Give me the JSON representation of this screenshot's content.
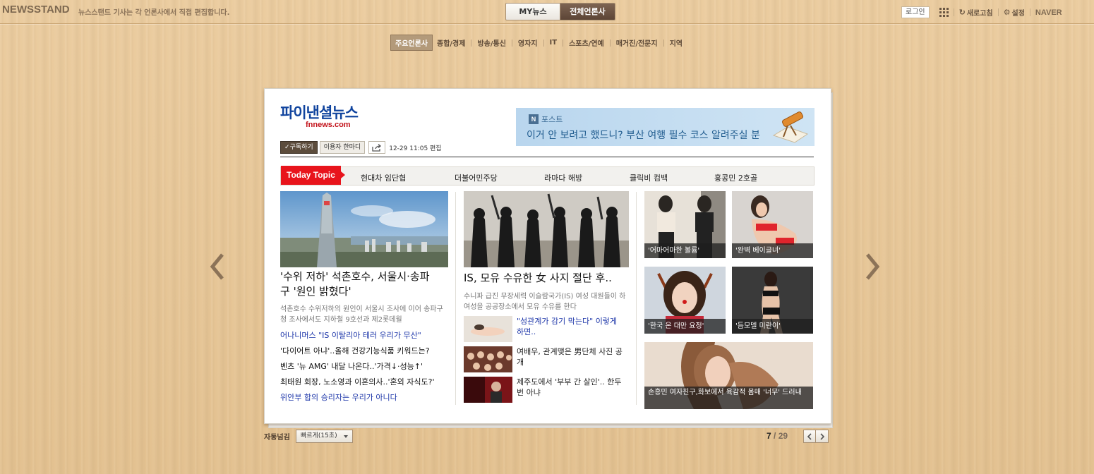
{
  "topbar": {
    "logo": "NEWSSTAND",
    "tagline": "뉴스스탠드 기사는 각 언론사에서 직접 편집합니다.",
    "tabs": {
      "my": "MY뉴스",
      "all": "전체언론사"
    },
    "login": "로그인",
    "refresh": "새로고침",
    "settings": "설정",
    "naver": "NAVER"
  },
  "categories": [
    "주요언론사",
    "종합/경제",
    "방송/통신",
    "영자지",
    "IT",
    "스포츠/연예",
    "매거진/전문지",
    "지역"
  ],
  "publisher": {
    "name": "파이낸셜뉴스",
    "url": "fnnews.com",
    "subscribe": "✓구독하기",
    "reader_voice": "이용자 한마디",
    "edit_time": "12-29 11:05 편집"
  },
  "banner": {
    "badge": "N",
    "label": "포스트",
    "headline": "이거 안 보려고 했드니? 부산 여행 필수 코스 알려주실 분"
  },
  "today_topic": {
    "tag": "Today Topic",
    "items": [
      "현대차 임단협",
      "더불어민주당",
      "라마다 해방",
      "클릭비 컴백",
      "홍콩민 2호골"
    ]
  },
  "col1": {
    "headline_line1": "'수위 저하' 석촌호수, 서울시·송파",
    "headline_line2": "구 '원인 밝혔다'",
    "summary": "석촌호수 수위저하의 원인이 서울시 조사에 이어 송파구청 조사에서도 지하철 9호선과 제2롯데월",
    "links": [
      "어나니머스 \"IS 이탈리아 테러 우리가 무산\"",
      "'다이어트 아냐'..올해 건강기능식품 키워드는?",
      "벤츠 '뉴 AMG' 내달 나온다..'가격↓·성능↑'",
      "최태원 회장, 노소영과 이혼의사..'혼외 자식도?'",
      "위안부 합의 승리자는 우리가 아니다"
    ]
  },
  "col2": {
    "headline": "IS, 모유 수유한 女 사지 절단 후..",
    "summary": "수니파 급진 무장세력 이슬람국가(IS) 여성 대원들이 하 여성을 공공장소에서 모유 수유를 한다",
    "thumbs": [
      "\"성관계가 감기 막는다\" 이렇게 하면..",
      "여배우, 관계맺은 男단체 사진 공개",
      "제주도에서 '부부 간 살인'.. 한두 번 아냐"
    ]
  },
  "col3": {
    "captions": [
      "'어마어마한 볼륨'",
      "'완벽 베이글녀'",
      "'한국 온 대만 요정'",
      "'듬모델 미란이'"
    ],
    "wide_caption": "손흥민 여자친구,화보에서 육감적 몸매 '너무' 드러내"
  },
  "footer": {
    "auto_label": "자동넘김",
    "auto_value": "빠르게(15초)",
    "page_current": "7",
    "page_sep": " / ",
    "page_total": "29"
  },
  "colors": {
    "accent_red": "#e8141c",
    "brand_blue": "#10449e",
    "link_blue": "#1b34a8",
    "wood": "#e6c596"
  }
}
